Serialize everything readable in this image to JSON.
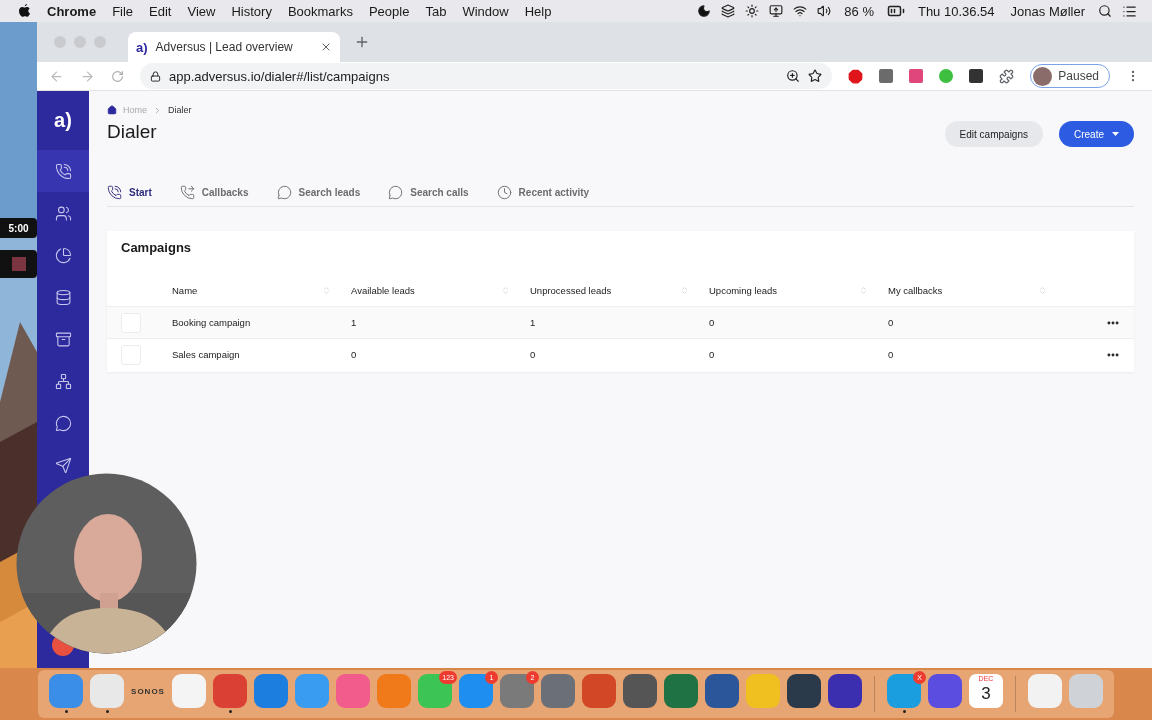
{
  "menu_bar": {
    "app": "Chrome",
    "menus": [
      "File",
      "Edit",
      "View",
      "History",
      "Bookmarks",
      "People",
      "Tab",
      "Window",
      "Help"
    ],
    "battery": "86 %",
    "clock": "Thu 10.36.54",
    "user": "Jonas Møller"
  },
  "browser": {
    "tab": {
      "favicon": "a)",
      "title": "Adversus | Lead overview"
    },
    "url": "app.adversus.io/dialer#/list/campaigns",
    "extensions": [
      {
        "kind": "stop",
        "color": "#e0151b"
      },
      {
        "kind": "square",
        "color": "#6b6b6b"
      },
      {
        "kind": "square",
        "color": "#e0457b"
      },
      {
        "kind": "round",
        "color": "#3fbf3f"
      },
      {
        "kind": "square",
        "color": "#333333"
      }
    ],
    "profile": "Paused"
  },
  "sidebar": {
    "logo": "a)",
    "items": [
      {
        "kind": "phone",
        "selected": true
      },
      {
        "kind": "people",
        "selected": false
      },
      {
        "kind": "pie",
        "selected": false
      },
      {
        "kind": "database",
        "selected": false
      },
      {
        "kind": "archive",
        "selected": false
      },
      {
        "kind": "network",
        "selected": false
      },
      {
        "kind": "chat",
        "selected": false
      },
      {
        "kind": "send",
        "selected": false
      }
    ]
  },
  "breadcrumb": [
    "Home",
    "Dialer"
  ],
  "title": "Dialer",
  "actions": {
    "edit": "Edit campaigns",
    "create": "Create"
  },
  "tabs": [
    {
      "label": "Start",
      "kind": "phone",
      "selected": true
    },
    {
      "label": "Callbacks",
      "kind": "callback",
      "selected": false
    },
    {
      "label": "Search leads",
      "kind": "chat",
      "selected": false
    },
    {
      "label": "Search calls",
      "kind": "chat",
      "selected": false
    },
    {
      "label": "Recent activity",
      "kind": "recent",
      "selected": false
    }
  ],
  "campaigns": {
    "title": "Campaigns",
    "columns": [
      "Name",
      "Available leads",
      "Unprocessed leads",
      "Upcoming leads",
      "My callbacks"
    ],
    "rows": [
      {
        "checked": false,
        "cells": [
          "Booking campaign",
          "1",
          "1",
          "0",
          "0"
        ]
      },
      {
        "checked": false,
        "cells": [
          "Sales campaign",
          "0",
          "0",
          "0",
          "0"
        ]
      }
    ]
  },
  "recorder": {
    "timer": "5:00"
  },
  "dock": [
    {
      "kind": "app",
      "color": "#3a8ee8",
      "running": true
    },
    {
      "kind": "app",
      "color": "#e8e8e8",
      "running": true
    },
    {
      "kind": "text",
      "label": "SONOS",
      "running": false
    },
    {
      "kind": "app",
      "color": "#f4f4f4",
      "running": false
    },
    {
      "kind": "app",
      "color": "#db4035",
      "running": true
    },
    {
      "kind": "app",
      "color": "#1c7fe0",
      "running": false
    },
    {
      "kind": "app",
      "color": "#3a9cf0",
      "running": false
    },
    {
      "kind": "app",
      "color": "#f25c8c",
      "running": false
    },
    {
      "kind": "app",
      "color": "#f07a1a",
      "running": false
    },
    {
      "kind": "app",
      "color": "#3cc455",
      "badge": "123",
      "running": false
    },
    {
      "kind": "app",
      "color": "#1e8ef0",
      "badge": "1",
      "running": false
    },
    {
      "kind": "app",
      "color": "#7a7a7a",
      "badge": "2",
      "running": false
    },
    {
      "kind": "app",
      "color": "#6a6f78",
      "running": false
    },
    {
      "kind": "app",
      "color": "#d24726",
      "running": false
    },
    {
      "kind": "app",
      "color": "#555555",
      "running": false
    },
    {
      "kind": "app",
      "color": "#1f7244",
      "running": false
    },
    {
      "kind": "app",
      "color": "#2b579a",
      "running": false
    },
    {
      "kind": "app",
      "color": "#f0c020",
      "running": false
    },
    {
      "kind": "app",
      "color": "#2a3a4a",
      "running": false
    },
    {
      "kind": "app",
      "color": "#3b2fb0",
      "running": false
    },
    {
      "kind": "divider"
    },
    {
      "kind": "app",
      "color": "#1a9ee0",
      "badge": "X",
      "running": true
    },
    {
      "kind": "app",
      "color": "#5a4de0",
      "running": false
    },
    {
      "kind": "calendar",
      "month": "DEC",
      "day": "3",
      "running": false
    },
    {
      "kind": "divider"
    },
    {
      "kind": "app",
      "color": "#f2f2f2",
      "running": false
    },
    {
      "kind": "app",
      "color": "#cfd3d8",
      "running": false
    }
  ]
}
